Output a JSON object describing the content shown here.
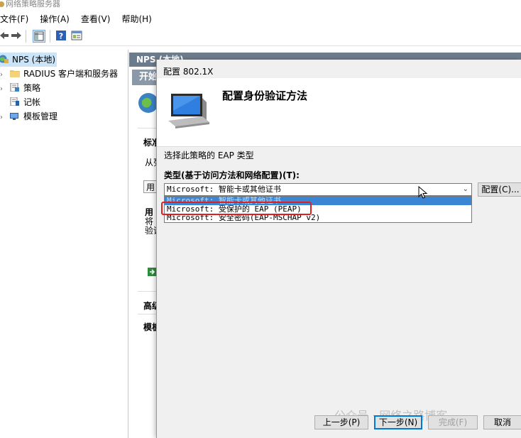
{
  "window": {
    "title": "网络策略服务器"
  },
  "menubar": {
    "items": [
      "文件(F)",
      "操作(A)",
      "查看(V)",
      "帮助(H)"
    ]
  },
  "tree": {
    "root": "NPS (本地)",
    "items": [
      "RADIUS 客户端和服务器",
      "策略",
      "记帐",
      "模板管理"
    ]
  },
  "right_pane": {
    "header": "NPS (本地)",
    "band": "开始",
    "fragments": {
      "standard": "标准",
      "from": "从列",
      "use_btn": "用",
      "use_label": "用",
      "line_will": "将",
      "line_verify": "验证",
      "advanced": "高级",
      "template": "模板"
    }
  },
  "dialog": {
    "title": "配置 802.1X",
    "heading": "配置身份验证方法",
    "instruction": "选择此策略的 EAP 类型",
    "type_label": "类型(基于访问方法和网络配置)(T):",
    "selected_value": "Microsoft: 智能卡或其他证书",
    "configure_button": "配置(C)...",
    "options": [
      "Microsoft: 智能卡或其他证书",
      "Microsoft: 受保护的 EAP (PEAP)",
      "Microsoft: 安全密码(EAP-MSCHAP v2)"
    ],
    "buttons": {
      "back": "上一步(P)",
      "next": "下一步(N)",
      "finish": "完成(F)",
      "cancel": "取消"
    }
  },
  "watermark": "公众号 · 网络之路博客",
  "colors": {
    "highlight": "#3a86d4",
    "annotation_box": "#e02020",
    "pane_header": "#6d7c8c"
  }
}
